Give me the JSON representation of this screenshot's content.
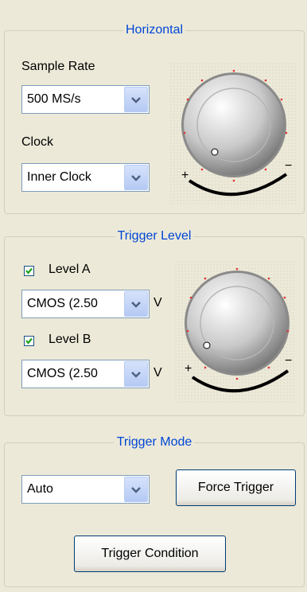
{
  "horizontal": {
    "title": "Horizontal",
    "sample_rate_label": "Sample Rate",
    "sample_rate_value": "500 MS/s",
    "clock_label": "Clock",
    "clock_value": "Inner Clock",
    "knob_plus": "+",
    "knob_minus": "−"
  },
  "trigger_level": {
    "title": "Trigger Level",
    "level_a_label": "Level A",
    "level_a_checked": true,
    "level_a_value": "CMOS (2.50",
    "level_a_unit": "V",
    "level_b_label": "Level B",
    "level_b_checked": true,
    "level_b_value": "CMOS (2.50",
    "level_b_unit": "V",
    "knob_plus": "+",
    "knob_minus": "−"
  },
  "trigger_mode": {
    "title": "Trigger Mode",
    "mode_value": "Auto",
    "force_trigger_label": "Force Trigger",
    "trigger_condition_label": "Trigger Condition"
  },
  "colors": {
    "group_title": "#0046D5",
    "background": "#ECE9D8",
    "knob_marks": "#E03030",
    "check": "#21A121"
  }
}
